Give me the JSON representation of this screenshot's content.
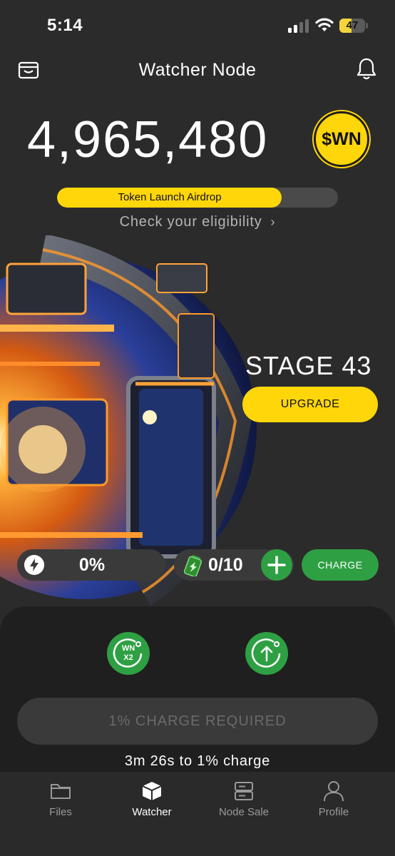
{
  "status_bar": {
    "time": "5:14",
    "battery_level": "47",
    "battery_fraction": 0.47
  },
  "header": {
    "title": "Watcher Node"
  },
  "balance": {
    "value": "4,965,480",
    "token": "$WN"
  },
  "airdrop": {
    "label": "Token Launch Airdrop",
    "progress": 0.8,
    "eligibility_link": "Check your eligibility"
  },
  "stage": {
    "title": "STAGE 43",
    "upgrade_label": "UPGRADE"
  },
  "charge": {
    "percent": "0%",
    "battery_count": "0/10",
    "charge_label": "CHARGE"
  },
  "boost": {
    "line1": "WN",
    "line2": "X2"
  },
  "action": {
    "required_label": "1% CHARGE REQUIRED",
    "countdown": "3m 26s to 1% charge"
  },
  "tabs": [
    {
      "label": "Files",
      "icon": "folder-icon"
    },
    {
      "label": "Watcher",
      "icon": "cube-icon"
    },
    {
      "label": "Node Sale",
      "icon": "server-icon"
    },
    {
      "label": "Profile",
      "icon": "person-icon"
    }
  ],
  "colors": {
    "accent": "#ffd60a",
    "success": "#2ea043",
    "background": "#2b2b2b",
    "panel": "#1f1f1f"
  }
}
